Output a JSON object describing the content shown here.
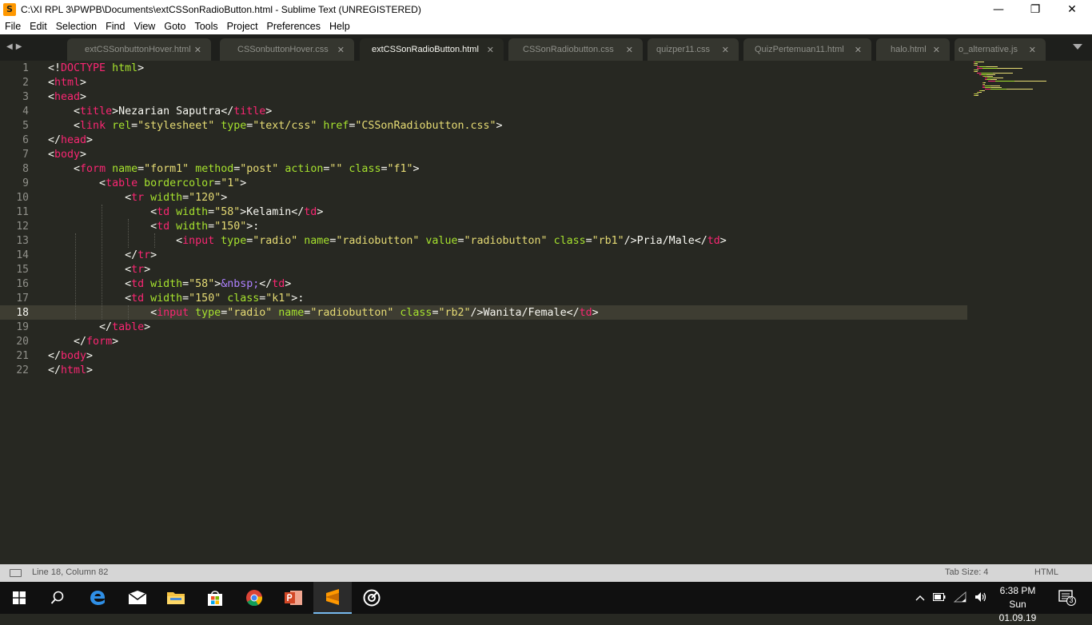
{
  "window": {
    "title": "C:\\XI RPL 3\\PWPB\\Documents\\extCSSonRadioButton.html - Sublime Text (UNREGISTERED)",
    "app_icon_glyph": "S",
    "minimize": "—",
    "maximize": "❐",
    "close": "✕"
  },
  "menu": [
    "File",
    "Edit",
    "Selection",
    "Find",
    "View",
    "Goto",
    "Tools",
    "Project",
    "Preferences",
    "Help"
  ],
  "tabs": [
    {
      "label": "extCSSonbuttonHover.html",
      "active": false
    },
    {
      "label": "CSSonbuttonHover.css",
      "active": false
    },
    {
      "label": "extCSSonRadioButton.html",
      "active": true
    },
    {
      "label": "CSSonRadiobutton.css",
      "active": false
    },
    {
      "label": "quizper11.css",
      "active": false
    },
    {
      "label": "QuizPertemuan11.html",
      "active": false
    },
    {
      "label": "halo.html",
      "active": false
    },
    {
      "label": "o_alternative.js",
      "active": false
    }
  ],
  "tab_close_glyph": "✕",
  "nav_arrows": "◀▶",
  "editor": {
    "line_numbers": [
      "1",
      "2",
      "3",
      "4",
      "5",
      "6",
      "7",
      "8",
      "9",
      "10",
      "11",
      "12",
      "13",
      "14",
      "15",
      "16",
      "17",
      "18",
      "19",
      "20",
      "21",
      "22"
    ],
    "current_line": 18,
    "code": [
      "<!DOCTYPE html>",
      "<html>",
      "<head>",
      "    <title>Nezarian Saputra</title>",
      "    <link rel=\"stylesheet\" type=\"text/css\" href=\"CSSonRadiobutton.css\">",
      "</head>",
      "<body>",
      "    <form name=\"form1\" method=\"post\" action=\"\" class=\"f1\">",
      "        <table bordercolor=\"1\">",
      "            <tr width=\"120\">",
      "                <td width=\"58\">Kelamin</td>",
      "                <td width=\"150\">:",
      "                    <input type=\"radio\" name=\"radiobutton\" value=\"radiobutton\" class=\"rb1\"/>Pria/Male</td>",
      "            </tr>",
      "            <tr>",
      "            <td width=\"58\">&nbsp;</td>",
      "            <td width=\"150\" class=\"k1\">:",
      "                <input type=\"radio\" name=\"radiobutton\" class=\"rb2\"/>Wanita/Female</td>",
      "        </table>",
      "    </form>",
      "</body>",
      "</html>"
    ]
  },
  "status": {
    "position": "Line 18, Column 82",
    "tab_size": "Tab Size: 4",
    "syntax": "HTML"
  },
  "taskbar": {
    "apps": [
      "windows-start",
      "search",
      "edge",
      "mail",
      "file-explorer",
      "store",
      "chrome",
      "powerpoint",
      "sublime-text",
      "groove"
    ],
    "clock_time": "6:38 PM",
    "clock_date": "Sun 01.09.19",
    "notification_count": "3"
  },
  "colors": {
    "editor_bg": "#272822",
    "tag": "#f92672",
    "attr": "#a6e22e",
    "string": "#e6db74",
    "entity": "#ae81ff",
    "text": "#f8f8f2"
  }
}
